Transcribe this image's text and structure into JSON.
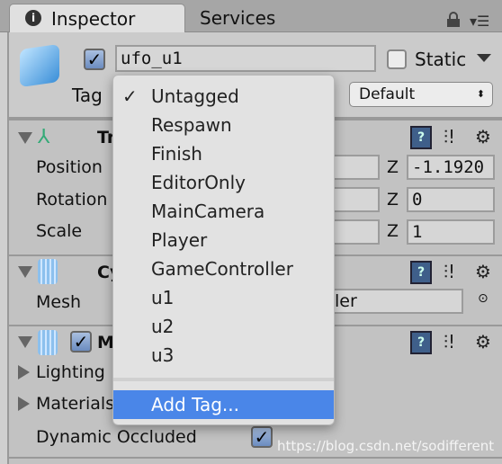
{
  "tabs": [
    {
      "label": "Inspector",
      "icon": "info-icon",
      "active": true
    },
    {
      "label": "Services",
      "active": false
    }
  ],
  "object": {
    "active": true,
    "name": "ufo_u1",
    "static_label": "Static",
    "static": false,
    "tag_label": "Tag",
    "layer_value": "Default"
  },
  "transform": {
    "title_partial": "Tr",
    "rows": [
      {
        "label": "Position",
        "z": "-1.1920"
      },
      {
        "label": "Rotation",
        "z": "0"
      },
      {
        "label": "Scale",
        "z": "1"
      }
    ],
    "z_label": "Z"
  },
  "mesh_filter": {
    "title_partial": "Cy",
    "mesh_label": "Mesh",
    "mesh_value_partial": "ler"
  },
  "mesh_renderer": {
    "title_partial": "M",
    "enabled": true,
    "rows": [
      "Lighting",
      "Materials"
    ],
    "dynamic_label": "Dynamic Occluded",
    "dynamic": true
  },
  "tag_menu": {
    "items": [
      "Untagged",
      "Respawn",
      "Finish",
      "EditorOnly",
      "MainCamera",
      "Player",
      "GameController",
      "u1",
      "u2",
      "u3"
    ],
    "selected": "Untagged",
    "check": "✓",
    "add_tag": "Add Tag..."
  },
  "watermark": "https://blog.csdn.net/sodifferent",
  "colors": {
    "highlight": "#4a86e8"
  }
}
